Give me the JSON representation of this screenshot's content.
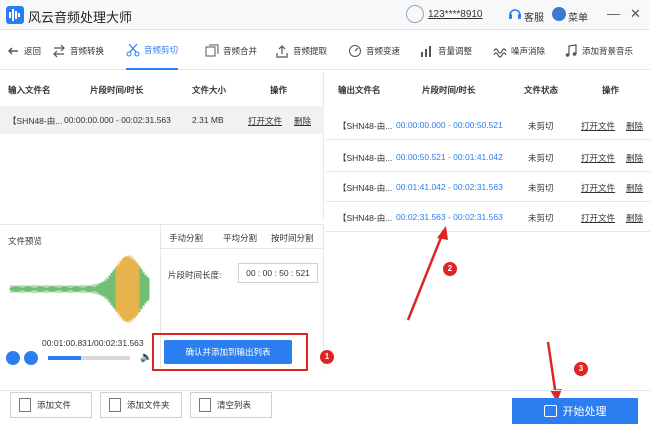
{
  "app": {
    "title": "风云音频处理大师",
    "user": "123****8910",
    "service": "客服",
    "menu": "菜单"
  },
  "toolbar": [
    {
      "label": "返回",
      "icon": "back-arrow-icon"
    },
    {
      "label": "音频转换",
      "icon": "convert-icon"
    },
    {
      "label": "音频剪切",
      "icon": "scissors-icon",
      "active": true
    },
    {
      "label": "音频合并",
      "icon": "merge-icon"
    },
    {
      "label": "音频提取",
      "icon": "extract-icon"
    },
    {
      "label": "音频变速",
      "icon": "speed-icon"
    },
    {
      "label": "音量调整",
      "icon": "volume-bars-icon"
    },
    {
      "label": "噪声消除",
      "icon": "noise-icon"
    },
    {
      "label": "添加背景音乐",
      "icon": "music-note-icon"
    }
  ],
  "input_table": {
    "headers": [
      "输入文件名",
      "片段时间/时长",
      "文件大小",
      "操作"
    ],
    "rows": [
      {
        "name": "【SHN48-由...",
        "range": "00:00:00.000 - 00:02:31.563",
        "size": "2.31 MB",
        "open": "打开文件",
        "del": "删除"
      }
    ]
  },
  "output_table": {
    "headers": [
      "输出文件名",
      "片段时间/时长",
      "文件状态",
      "操作"
    ],
    "rows": [
      {
        "name": "【SHN48-由...",
        "range": "00:00:00.000 - 00:00:50.521",
        "status": "未剪切",
        "open": "打开文件",
        "del": "删除"
      },
      {
        "name": "【SHN48-由...",
        "range": "00:00:50.521 - 00:01:41.042",
        "status": "未剪切",
        "open": "打开文件",
        "del": "删除"
      },
      {
        "name": "【SHN48-由...",
        "range": "00:01:41.042 - 00:02:31.563",
        "status": "未剪切",
        "open": "打开文件",
        "del": "删除"
      },
      {
        "name": "【SHN48-由...",
        "range": "00:02:31.563 - 00:02:31.563",
        "status": "未剪切",
        "open": "打开文件",
        "del": "删除"
      }
    ]
  },
  "preview": {
    "label": "文件预览",
    "time": "00:01:00.831/00:02:31.563",
    "progress": 0.4
  },
  "split": {
    "tabs": [
      "手动分割",
      "平均分割",
      "按时间分割"
    ],
    "active_tab": 2,
    "segment_label": "片段时间长度:",
    "segment_value": "00 : 00 : 50 : 521",
    "confirm": "确认并添加到输出列表"
  },
  "bottom": {
    "add_file": "添加文件",
    "add_folder": "添加文件夹",
    "clear": "清空列表",
    "start": "开始处理"
  },
  "annotations": [
    "1",
    "2",
    "3"
  ],
  "colors": {
    "accent": "#2a7ef0",
    "annotation": "#e02424"
  }
}
